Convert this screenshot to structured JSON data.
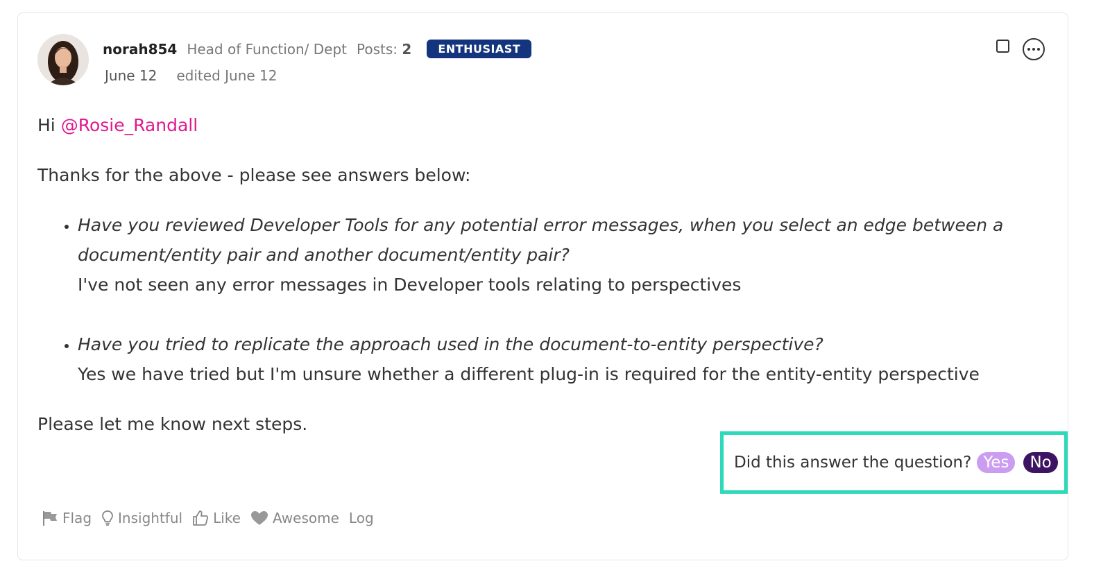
{
  "post": {
    "author": {
      "username": "norah854",
      "role": "Head of Function/ Dept",
      "posts_label": "Posts:",
      "posts_count": "2",
      "badge": "ENTHUSIAST",
      "avatar_icon": "user-avatar-photo"
    },
    "date": "June 12",
    "edited": "edited June 12",
    "greeting_prefix": "Hi",
    "mention": "@Rosie_Randall",
    "intro": "Thanks for the above - please see answers below:",
    "qa": [
      {
        "question": "Have you reviewed Developer Tools for any potential error messages, when you select an edge between a document/entity pair and another document/entity pair?",
        "answer": "I've not seen any error messages in Developer tools relating to perspectives"
      },
      {
        "question": "Have you tried to replicate the approach used in the document-to-entity perspective?",
        "answer": "Yes we have tried but I'm unsure whether a different plug-in is required for the entity-entity perspective"
      }
    ],
    "closing": "Please let me know next steps."
  },
  "answer_prompt": {
    "question": "Did this answer the question?",
    "yes_label": "Yes",
    "no_label": "No"
  },
  "reactions": [
    {
      "label": "Flag",
      "icon": "flag-icon"
    },
    {
      "label": "Insightful",
      "icon": "lightbulb-icon"
    },
    {
      "label": "Like",
      "icon": "thumbs-up-icon"
    },
    {
      "label": "Awesome",
      "icon": "heart-icon"
    },
    {
      "label": "Log",
      "icon": ""
    }
  ],
  "colors": {
    "mention": "#e0198f",
    "badge": "#14357d",
    "highlight_border": "#2cd9b8",
    "yes_button": "#cb9df0",
    "no_button": "#3d1463"
  }
}
